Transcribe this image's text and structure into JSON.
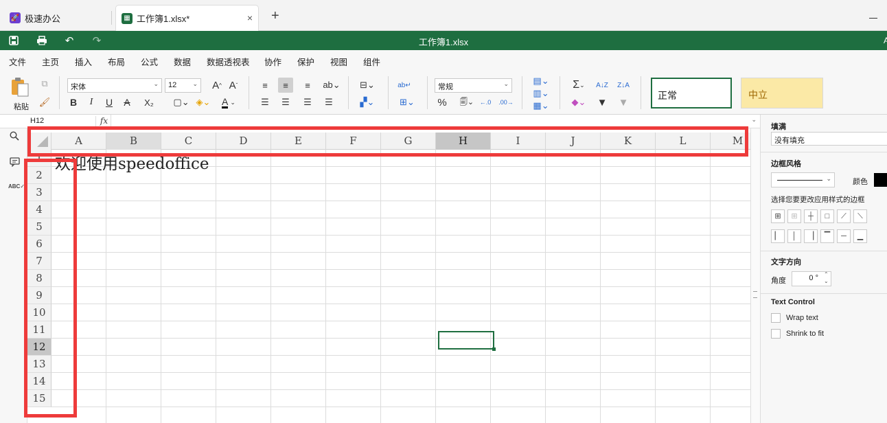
{
  "tabs": [
    {
      "label": "极速办公",
      "icon": "rocket-icon",
      "color": "#6c3fd1"
    },
    {
      "label": "工作簿1.xlsx*",
      "icon": "spreadsheet-icon",
      "color": "#1e6e40",
      "close": "×"
    }
  ],
  "new_tab": "+",
  "title": "工作簿1.xlsx",
  "brand_color": "#1e6e40",
  "menu": [
    "文件",
    "主页",
    "插入",
    "布局",
    "公式",
    "数据",
    "数据透视表",
    "协作",
    "保护",
    "视图",
    "组件"
  ],
  "toolbar": {
    "paste_label": "粘贴",
    "font_name": "宋体",
    "font_size": "12",
    "number_format": "常规",
    "style_normal": "正常",
    "style_neutral": "中立",
    "bold": "B",
    "italic": "I",
    "underline": "U",
    "strike": "A",
    "subscript": "X₂",
    "font_color_letter": "A",
    "percent": "%",
    "sum": "Σ"
  },
  "formula_bar": {
    "cell_ref": "H12",
    "fx": "fx",
    "value": ""
  },
  "columns": [
    "A",
    "B",
    "C",
    "D",
    "E",
    "F",
    "G",
    "H",
    "I",
    "J",
    "K",
    "L",
    "M"
  ],
  "selected_column": "H",
  "rows": [
    "1",
    "2",
    "3",
    "4",
    "5",
    "6",
    "7",
    "8",
    "9",
    "10",
    "11",
    "12",
    "13",
    "14",
    "15"
  ],
  "selected_row": "12",
  "cell_a1": "欢迎使用speedoffice",
  "right_panel": {
    "fill_title": "填满",
    "fill_value": "没有填充",
    "border_style_title": "边框风格",
    "color_label": "颜色",
    "border_hint": "选择您要更改应用样式的边框",
    "text_direction_title": "文字方向",
    "angle_label": "角度",
    "angle_value": "0 °",
    "text_control_title": "Text Control",
    "wrap_text": "Wrap text",
    "shrink_to_fit": "Shrink to fit"
  }
}
